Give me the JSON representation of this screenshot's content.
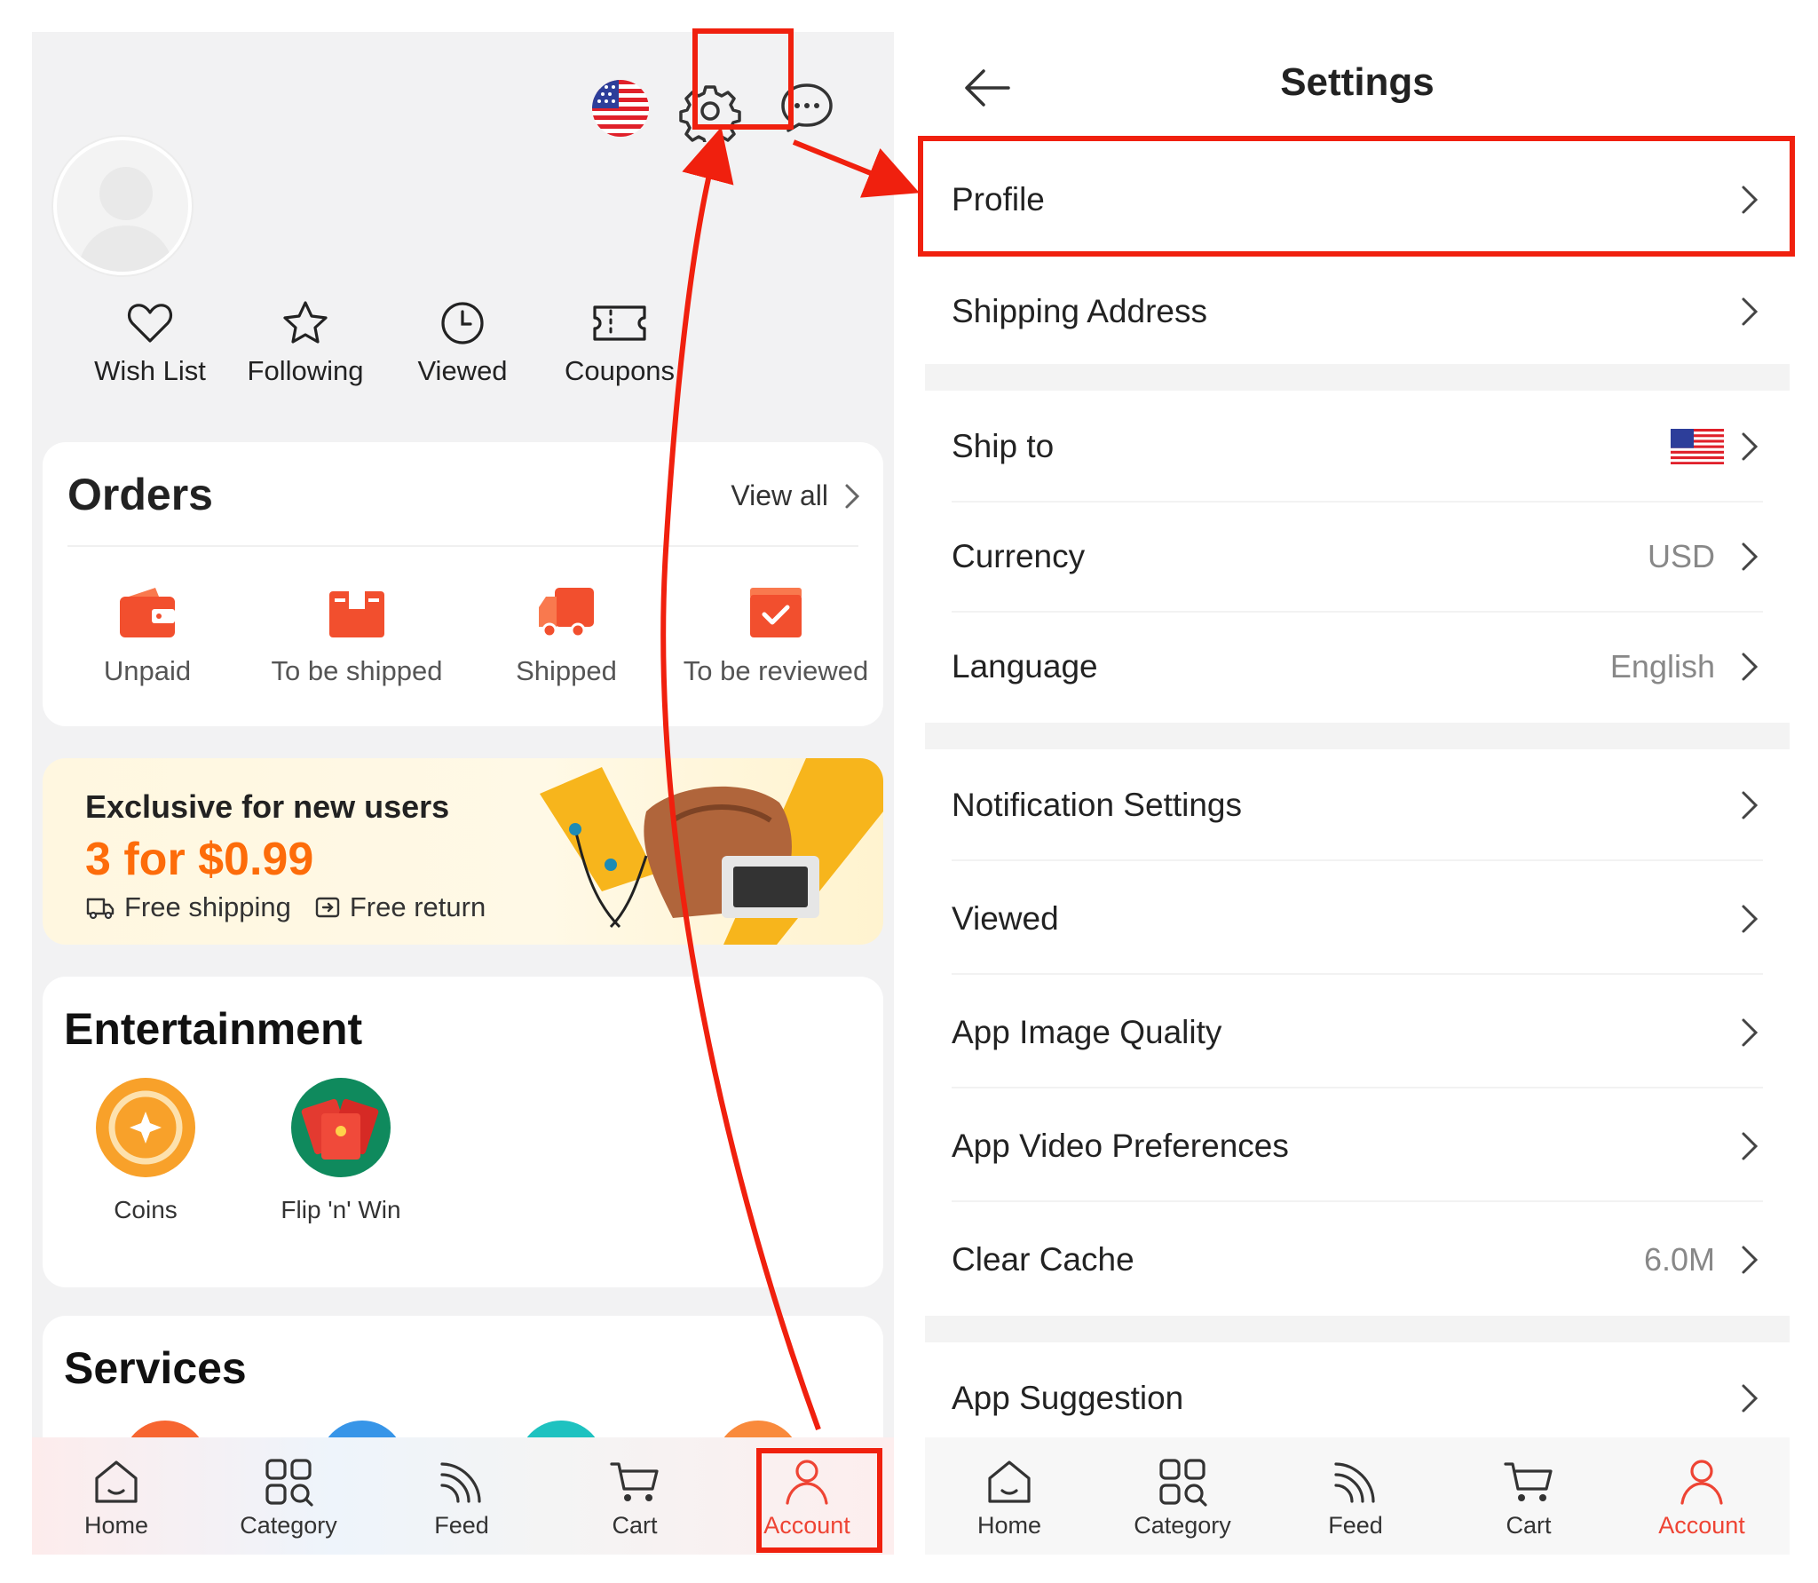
{
  "left": {
    "quick": [
      {
        "label": "Wish List",
        "icon": "heart-icon"
      },
      {
        "label": "Following",
        "icon": "star-icon"
      },
      {
        "label": "Viewed",
        "icon": "clock-icon"
      },
      {
        "label": "Coupons",
        "icon": "ticket-icon"
      }
    ],
    "orders": {
      "title": "Orders",
      "view_all": "View all",
      "items": [
        {
          "label": "Unpaid",
          "icon": "wallet-icon"
        },
        {
          "label": "To be shipped",
          "icon": "box-icon"
        },
        {
          "label": "Shipped",
          "icon": "truck-icon"
        },
        {
          "label": "To be reviewed",
          "icon": "review-check-icon"
        }
      ]
    },
    "promo": {
      "title": "Exclusive for new users",
      "price": "3 for $0.99",
      "free_shipping": "Free shipping",
      "free_return": "Free return"
    },
    "entertainment": {
      "title": "Entertainment",
      "items": [
        {
          "label": "Coins",
          "icon": "coin-icon"
        },
        {
          "label": "Flip 'n' Win",
          "icon": "red-envelope-icon"
        }
      ]
    },
    "services": {
      "title": "Services"
    }
  },
  "tabs": [
    {
      "label": "Home",
      "icon": "home-icon"
    },
    {
      "label": "Category",
      "icon": "category-icon"
    },
    {
      "label": "Feed",
      "icon": "feed-icon"
    },
    {
      "label": "Cart",
      "icon": "cart-icon"
    },
    {
      "label": "Account",
      "icon": "account-icon",
      "active": true
    }
  ],
  "settings": {
    "title": "Settings",
    "rows": [
      {
        "label": "Profile",
        "value": ""
      },
      {
        "label": "Shipping Address",
        "value": ""
      },
      {
        "label": "Ship to",
        "value": ""
      },
      {
        "label": "Currency",
        "value": "USD"
      },
      {
        "label": "Language",
        "value": "English"
      },
      {
        "label": "Notification Settings",
        "value": ""
      },
      {
        "label": "Viewed",
        "value": ""
      },
      {
        "label": "App Image Quality",
        "value": ""
      },
      {
        "label": "App Video Preferences",
        "value": ""
      },
      {
        "label": "Clear Cache",
        "value": "6.0M"
      },
      {
        "label": "App Suggestion",
        "value": ""
      }
    ]
  },
  "colors": {
    "accent": "#ee4434",
    "highlight": "#f0200e",
    "promo_price": "#fd6c0a"
  }
}
